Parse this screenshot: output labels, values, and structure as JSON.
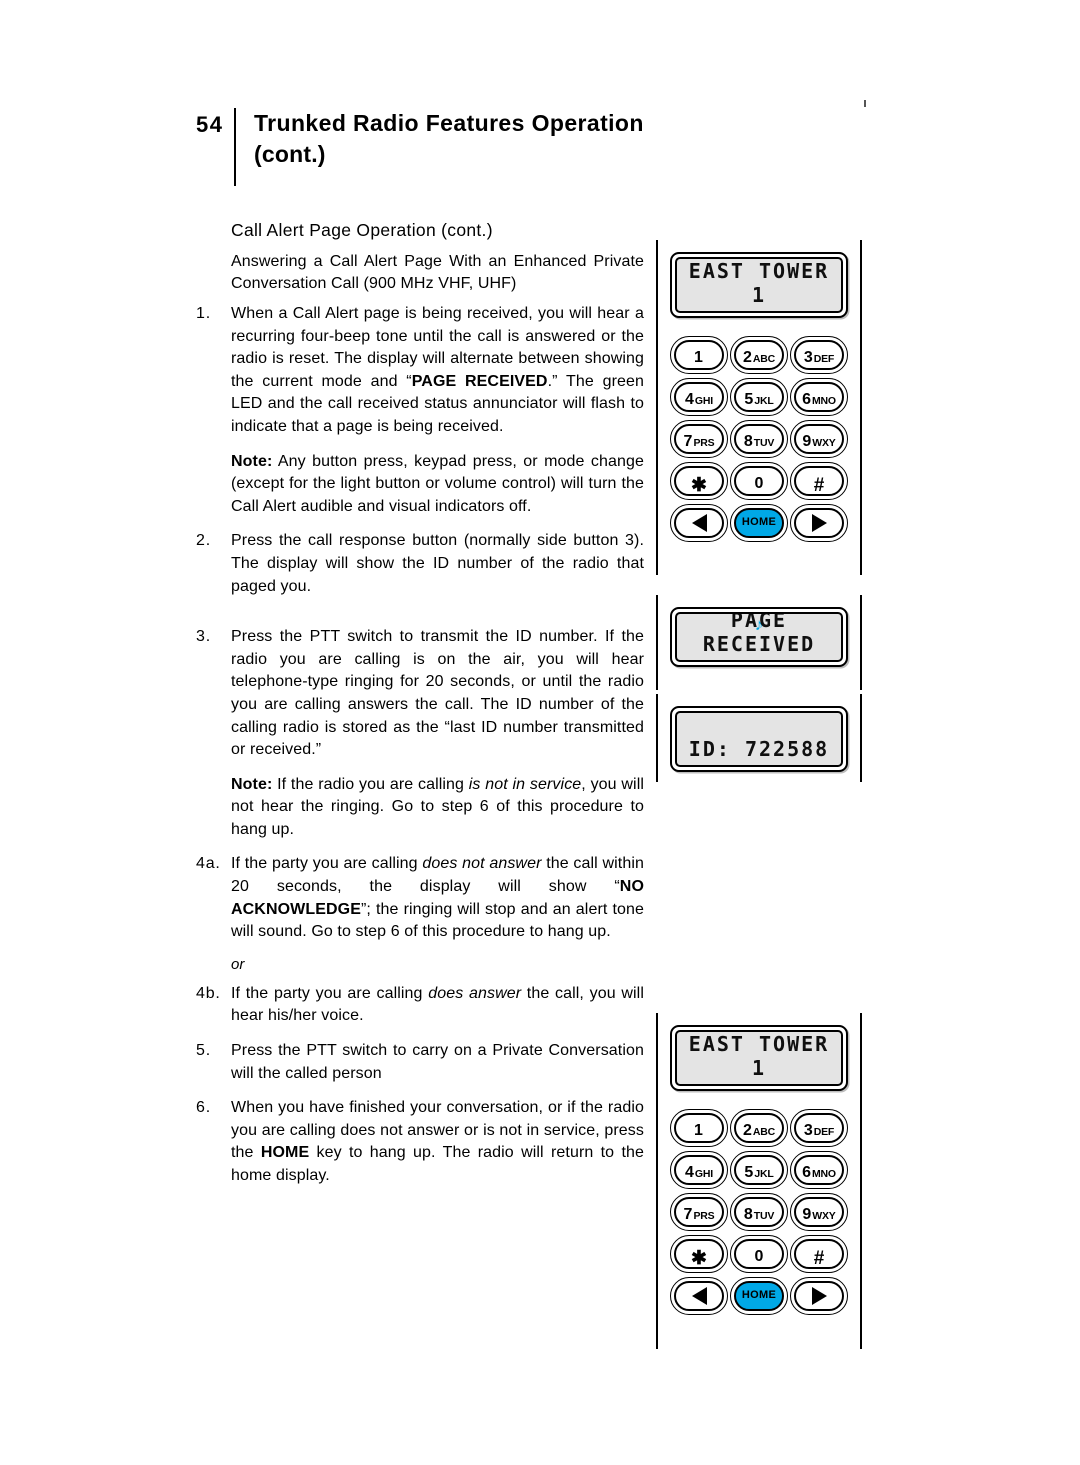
{
  "header": {
    "page_number": "54",
    "title_line1": "Trunked Radio Features Operation",
    "title_line2": "(cont.)"
  },
  "content": {
    "section_heading": "Call Alert Page Operation (cont.)",
    "intro": "Answering a Call Alert Page With an Enhanced Private Conversation Call (900 MHz VHF, UHF)",
    "step1_num": "1.",
    "note1_label": "Note:",
    "note1_text": " Any button press, keypad press, or mode change (except for the light button or volume control) will turn the Call Alert audible and visual indicators off.",
    "step2_num": "2.",
    "step2_text": "Press the call response button (normally side button 3). The display will show the ID number of the radio that paged you.",
    "step3_num": "3.",
    "step3_text": "Press the PTT switch to transmit the ID number. If the radio you are calling is on the air, you will hear telephone-type ringing for 20 seconds, or until the radio you are calling answers the call. The ID number of the calling radio is stored as the “last ID number transmitted or received.”",
    "note2_label": "Note:",
    "step4a_num": "4a.",
    "or_label": "or",
    "step4b_num": "4b.",
    "step5_num": "5.",
    "step5_text": "Press the PTT switch to carry on a Private Conversation will the called person",
    "step6_num": "6."
  },
  "illustrations": {
    "radio_top": {
      "display_text": "EAST TOWER 1",
      "keys": [
        {
          "digit": "1",
          "letters": ""
        },
        {
          "digit": "2",
          "letters": "ABC"
        },
        {
          "digit": "3",
          "letters": "DEF"
        },
        {
          "digit": "4",
          "letters": "GHI"
        },
        {
          "digit": "5",
          "letters": "JKL"
        },
        {
          "digit": "6",
          "letters": "MNO"
        },
        {
          "digit": "7",
          "letters": "PRS"
        },
        {
          "digit": "8",
          "letters": "TUV"
        },
        {
          "digit": "9",
          "letters": "WXY"
        }
      ],
      "star_key": "✱",
      "zero_key": "0",
      "hash_key": "#",
      "home_key": "HOME"
    },
    "display_page_received": {
      "icon": "music-note",
      "text": "PAGE RECEIVED"
    },
    "display_id": {
      "text": "ID: 722588"
    },
    "radio_bottom": {
      "display_text": "EAST TOWER 1"
    }
  },
  "colors": {
    "home_key": "#00a8e6",
    "lcd_background": "#e4e4e4",
    "music_note": "#00a8e6"
  }
}
